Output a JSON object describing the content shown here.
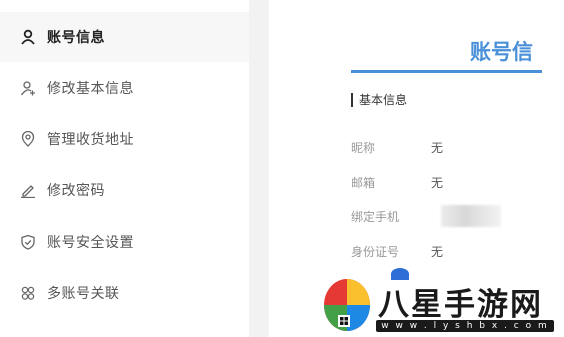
{
  "sidebar": {
    "items": [
      {
        "label": "账号信息",
        "icon": "user-icon",
        "active": true
      },
      {
        "label": "修改基本信息",
        "icon": "user-plus-icon",
        "active": false
      },
      {
        "label": "管理收货地址",
        "icon": "location-pin-icon",
        "active": false
      },
      {
        "label": "修改密码",
        "icon": "pencil-icon",
        "active": false
      },
      {
        "label": "账号安全设置",
        "icon": "shield-check-icon",
        "active": false
      },
      {
        "label": "多账号关联",
        "icon": "linked-accounts-icon",
        "active": false
      }
    ]
  },
  "main": {
    "title": "账号信",
    "section_title": "基本信息",
    "fields": [
      {
        "label": "昵称",
        "value": "无"
      },
      {
        "label": "邮箱",
        "value": "无"
      },
      {
        "label": "绑定手机",
        "value": ""
      },
      {
        "label": "身份证号",
        "value": "无"
      }
    ]
  },
  "watermark": {
    "text": "八星手游网",
    "url": "w w w . l y s h b x . c o m"
  },
  "colors": {
    "accent": "#4a90d9",
    "active_bg": "#f7f7f7",
    "gutter": "#f2f2f2"
  }
}
